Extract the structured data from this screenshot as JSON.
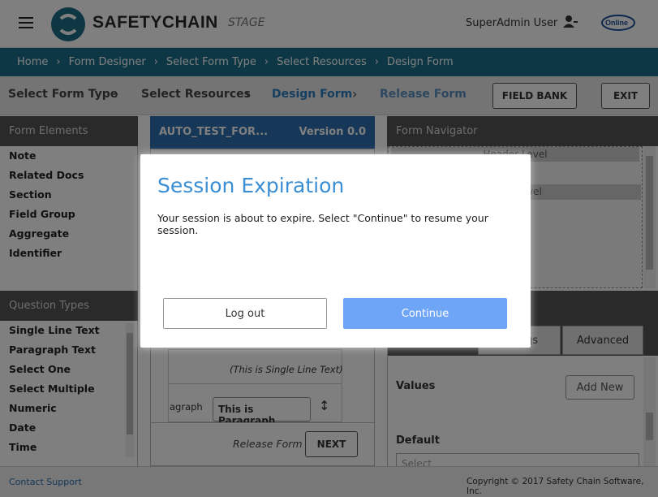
{
  "header": {
    "logo_text": "SAFETYCHAIN",
    "env_label": "STAGE",
    "user_name": "SuperAdmin User",
    "brand_icon": "online-level-logo"
  },
  "breadcrumb": [
    "Home",
    "Form Designer",
    "Select Form Type",
    "Select Resources",
    "Design Form"
  ],
  "steps": {
    "select_form_type": "Select Form Type",
    "select_resources": "Select Resources",
    "design_form": "Design Form",
    "release_form": "Release Form",
    "field_bank": "FIELD BANK",
    "exit": "EXIT"
  },
  "left_panel": {
    "elements_title": "Form Elements",
    "elements": [
      "Note",
      "Related Docs",
      "Section",
      "Field Group",
      "Aggregate",
      "Identifier"
    ],
    "question_types_title": "Question Types",
    "question_types": [
      "Single Line Text",
      "Paragraph Text",
      "Select One",
      "Select Multiple",
      "Numeric",
      "Date",
      "Time"
    ]
  },
  "middle": {
    "form_name": "AUTO_TEST_FOR...",
    "version": "Version 0.0",
    "single_line_hint": "(This is Single Line Text)",
    "paragraph_label": "agraph",
    "paragraph_value": "This is Paragraph",
    "release_form_label": "Release Form",
    "next_button": "NEXT"
  },
  "right_panel": {
    "title": "Form Navigator",
    "header_level": "Header Level",
    "level_partial": "vel",
    "tab_partial": "gs",
    "tab_advanced": "Advanced",
    "values_label": "Values",
    "add_new": "Add New",
    "default_label": "Default",
    "select_placeholder": "Select"
  },
  "footer": {
    "contact": "Contact Support",
    "copyright": "Copyright © 2017 Safety Chain Software, Inc."
  },
  "modal": {
    "title": "Session Expiration",
    "message": "Your session is about to expire. Select \"Continue\" to resume your session.",
    "logout": "Log out",
    "continue": "Continue",
    "accent": "#3a8fd4",
    "continue_color": "#6ea5f6"
  }
}
